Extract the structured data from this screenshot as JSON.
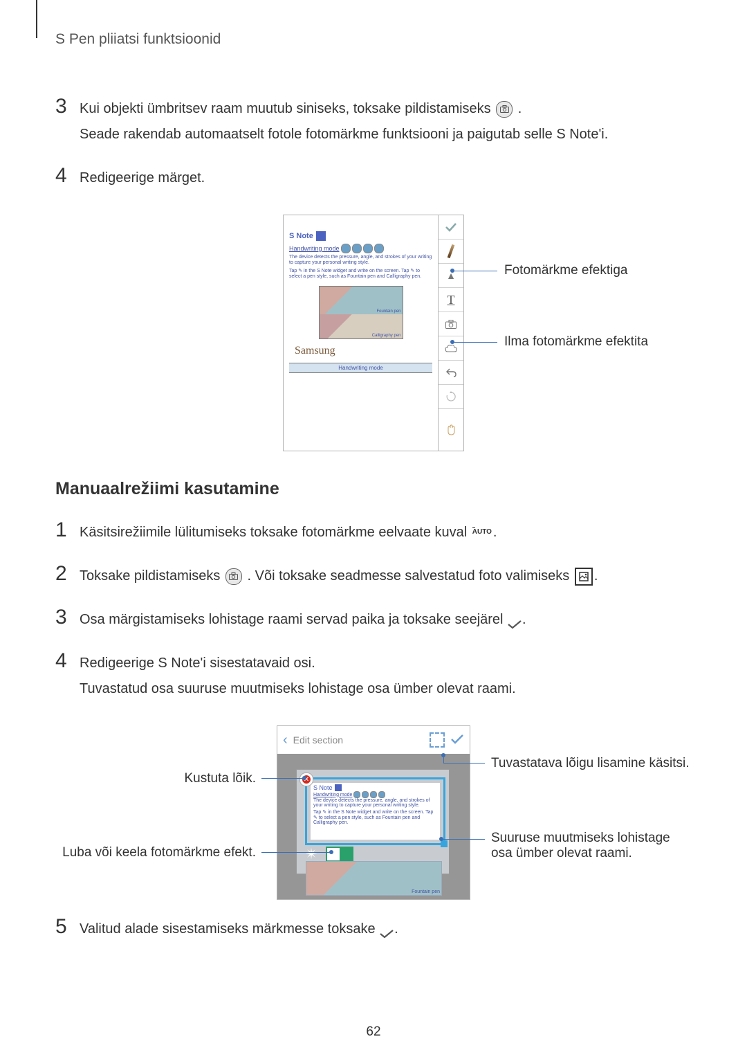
{
  "header": {
    "section_title": "S Pen pliiatsi funktsioonid"
  },
  "steps_top": {
    "s3_num": "3",
    "s3_line1_before": "Kui objekti ümbritsev raam muutub siniseks, toksake pildistamiseks ",
    "s3_line1_after": ".",
    "s3_line2": "Seade rakendab automaatselt fotole fotomärkme funktsiooni ja paigutab selle S Note'i.",
    "s4_num": "4",
    "s4_line1": "Redigeerige märget."
  },
  "figure1": {
    "text": {
      "snote": "S Note",
      "handwriting": "Handwriting mode",
      "desc": "The device detects the pressure, angle, and strokes of your writing to capture your personal writing style.",
      "tip": "Tap ✎ in the S Note widget and write on the screen. Tap ✎ to select a pen style, such as Fountain pen and Calligraphy pen.",
      "footer": "Handwriting mode",
      "fountain": "Fountain pen",
      "calligraphy": "Calligraphy pen"
    },
    "callouts": {
      "top": "Fotomärkme efektiga",
      "bottom": "Ilma fotomärkme efektita"
    }
  },
  "subheading": "Manuaalrežiimi kasutamine",
  "steps_bottom": {
    "s1_num": "1",
    "s1_before": "Käsitsirežiimile lülitumiseks toksake fotomärkme eelvaate kuval ",
    "s1_auto": "AUTO",
    "s1_after": ".",
    "s2_num": "2",
    "s2_before": "Toksake pildistamiseks ",
    "s2_mid": ". Või toksake seadmesse salvestatud foto valimiseks ",
    "s2_after": ".",
    "s3_num": "3",
    "s3_before": "Osa märgistamiseks lohistage raami servad paika ja toksake seejärel ",
    "s3_after": ".",
    "s4_num": "4",
    "s4_line1": "Redigeerige S Note'i sisestatavaid osi.",
    "s4_line2": "Tuvastatud osa suuruse muutmiseks lohistage osa ümber olevat raami.",
    "s5_num": "5",
    "s5_before": "Valitud alade sisestamiseks märkmesse toksake ",
    "s5_after": "."
  },
  "figure2": {
    "topbar": {
      "title": "Edit section"
    },
    "inner": {
      "snote": "S Note",
      "handwriting": "Handwriting mode",
      "desc": "The device detects the pressure, angle, and strokes of your writing to capture your personal writing style.",
      "tip": "Tap ✎ in the S Note widget and write on the screen. Tap ✎ to select a pen style, such as Fountain pen and Calligraphy pen.",
      "fountain": "Fountain pen"
    },
    "callouts": {
      "right_top": "Tuvastatava lõigu lisamine käsitsi.",
      "left_del": "Kustuta lõik.",
      "right_resize_l1": "Suuruse muutmiseks lohistage",
      "right_resize_l2": "osa ümber olevat raami.",
      "left_toggle": "Luba või keela fotomärkme efekt."
    }
  },
  "page_number": "62"
}
